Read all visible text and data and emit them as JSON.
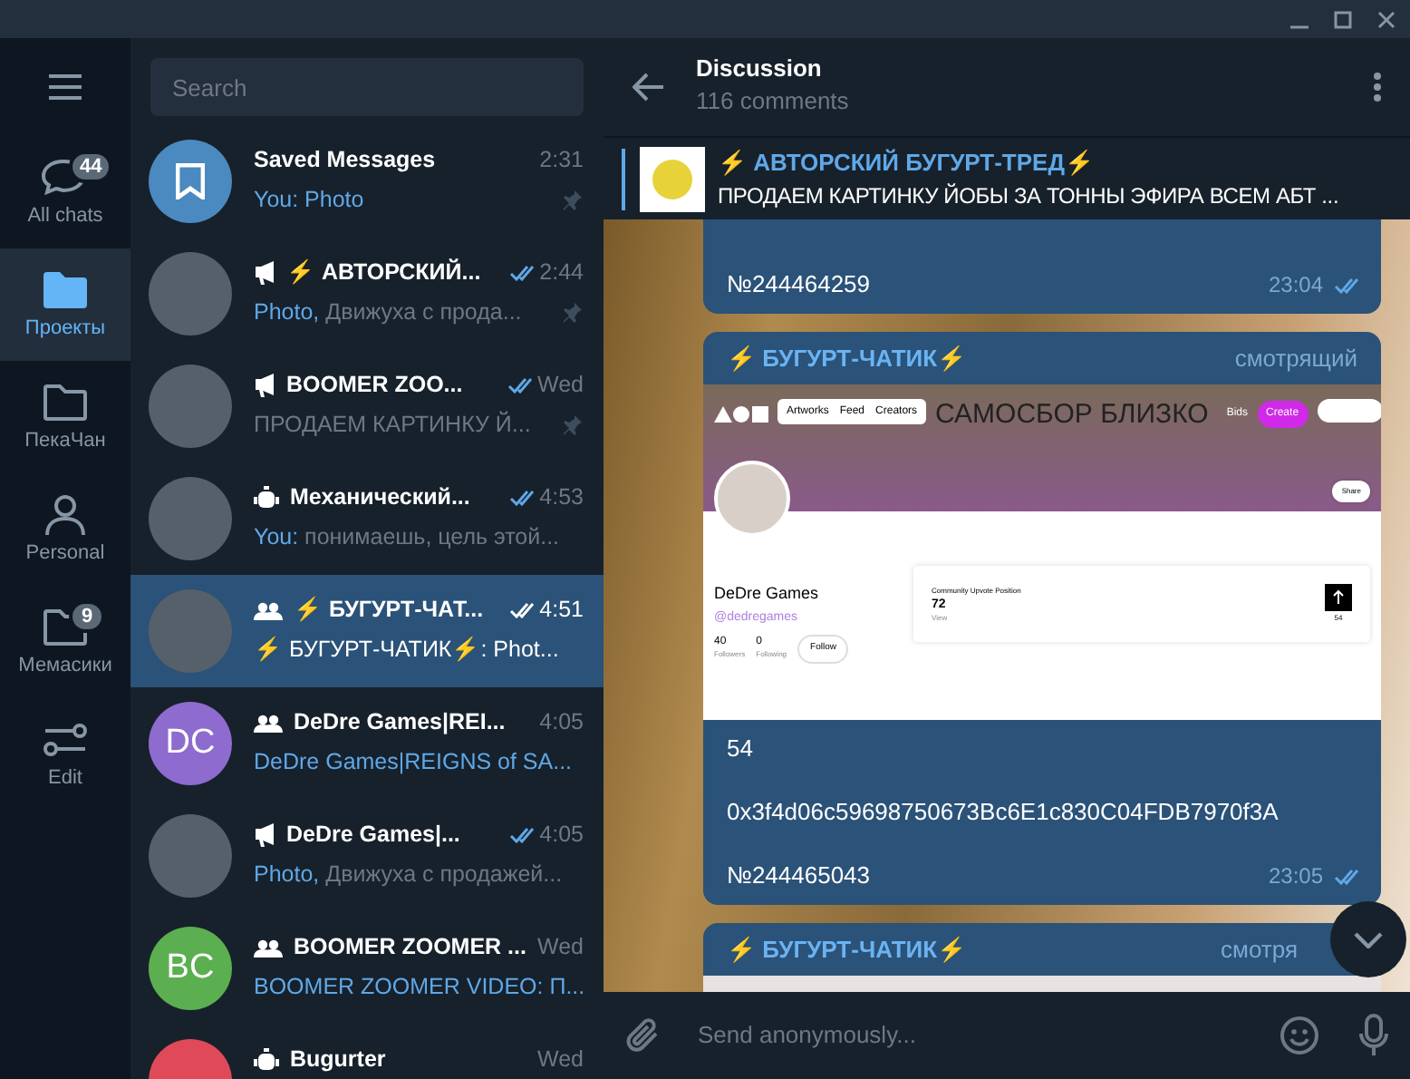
{
  "rail": {
    "folders": [
      {
        "label": "All chats",
        "badge": "44",
        "selected": false
      },
      {
        "label": "Проекты",
        "selected": true
      },
      {
        "label": "ПекаЧан",
        "selected": false
      },
      {
        "label": "Personal",
        "selected": false
      },
      {
        "label": "Мемасики",
        "badge": "9",
        "selected": false
      },
      {
        "label": "Edit",
        "selected": false
      }
    ]
  },
  "search": {
    "placeholder": "Search"
  },
  "chats": [
    {
      "kind": "saved",
      "name": "Saved Messages",
      "time": "2:31",
      "preview_prefix": "You: Photo",
      "read": false,
      "pinned": true,
      "selected": false
    },
    {
      "kind": "channel",
      "name": "⚡ АВТОРСКИЙ...",
      "time": "2:44",
      "preview_prefix": "Photo,",
      "preview": " Движуха с прода...",
      "read": true,
      "pinned": true,
      "selected": false
    },
    {
      "kind": "channel",
      "name": "BOOMER ZOO...",
      "time": "Wed",
      "preview": "ПРОДАЕМ КАРТИНКУ Й...",
      "read": true,
      "pinned": true,
      "selected": false
    },
    {
      "kind": "bot",
      "name": "Механический...",
      "time": "4:53",
      "preview_prefix": "You:",
      "preview": " понимаешь, цель этой...",
      "read": true,
      "pinned": false,
      "selected": false
    },
    {
      "kind": "group",
      "name": "⚡ БУГУРТ-ЧАТ...",
      "time": "4:51",
      "preview": "⚡ БУГУРТ-ЧАТИК⚡: Phot...",
      "read": true,
      "pinned": false,
      "selected": true
    },
    {
      "kind": "group",
      "initials": "DC",
      "color": "#8e6bcf",
      "name": "DeDre Games|REI...",
      "time": "4:05",
      "preview_prefix": "DeDre Games|REIGNS of SA...",
      "read": false,
      "pinned": false,
      "selected": false
    },
    {
      "kind": "channel",
      "name": "DeDre Games|...",
      "time": "4:05",
      "preview_prefix": "Photo,",
      "preview": " Движуха с продажей...",
      "read": true,
      "pinned": false,
      "selected": false
    },
    {
      "kind": "group",
      "initials": "BC",
      "color": "#5caf50",
      "name": "BOOMER ZOOMER ...",
      "time": "Wed",
      "preview_prefix": "BOOMER ZOOMER VIDEO: П...",
      "read": false,
      "pinned": false,
      "selected": false
    },
    {
      "kind": "bot",
      "color": "#e04a58",
      "name": "Bugurter",
      "time": "Wed",
      "read": false,
      "pinned": false,
      "selected": false
    }
  ],
  "chat_header": {
    "title": "Discussion",
    "subtitle": "116 comments"
  },
  "pinned_message": {
    "title": "⚡ АВТОРСКИЙ БУГУРТ-ТРЕД⚡",
    "text": "ПРОДАЕМ КАРТИНКУ ЙОБЫ ЗА ТОННЫ ЭФИРА ВСЕМ АБТ ..."
  },
  "messages": [
    {
      "lines": [
        "№244464259"
      ],
      "time": "23:04",
      "read": true
    },
    {
      "sender": "⚡ БУГУРТ-ЧАТИК⚡",
      "role": "смотрящий",
      "attachment": {
        "kind": "screenshot",
        "banner_text": "САМОСБОР БЛИЗКО",
        "nav": [
          "Artworks",
          "Feed",
          "Creators"
        ],
        "bids": "Bids",
        "create": "Create",
        "share": "Share",
        "name": "DeDre Games",
        "handle": "@dedregames",
        "stats": [
          {
            "value": "40",
            "label": "Followers"
          },
          {
            "value": "0",
            "label": "Following"
          }
        ],
        "follow": "Follow",
        "card_title": "Community Upvote Position",
        "card_value": "72",
        "card_link": "View",
        "card_count": "54"
      },
      "lines": [
        "54",
        "0x3f4d06c59698750673Bc6E1c830C04FDB7970f3A",
        "№244465043"
      ],
      "time": "23:05",
      "read": true
    },
    {
      "sender": "⚡ БУГУРТ-ЧАТИК⚡",
      "role": "смотря",
      "attachment": {
        "kind": "photo"
      }
    }
  ],
  "composer": {
    "placeholder": "Send anonymously..."
  }
}
